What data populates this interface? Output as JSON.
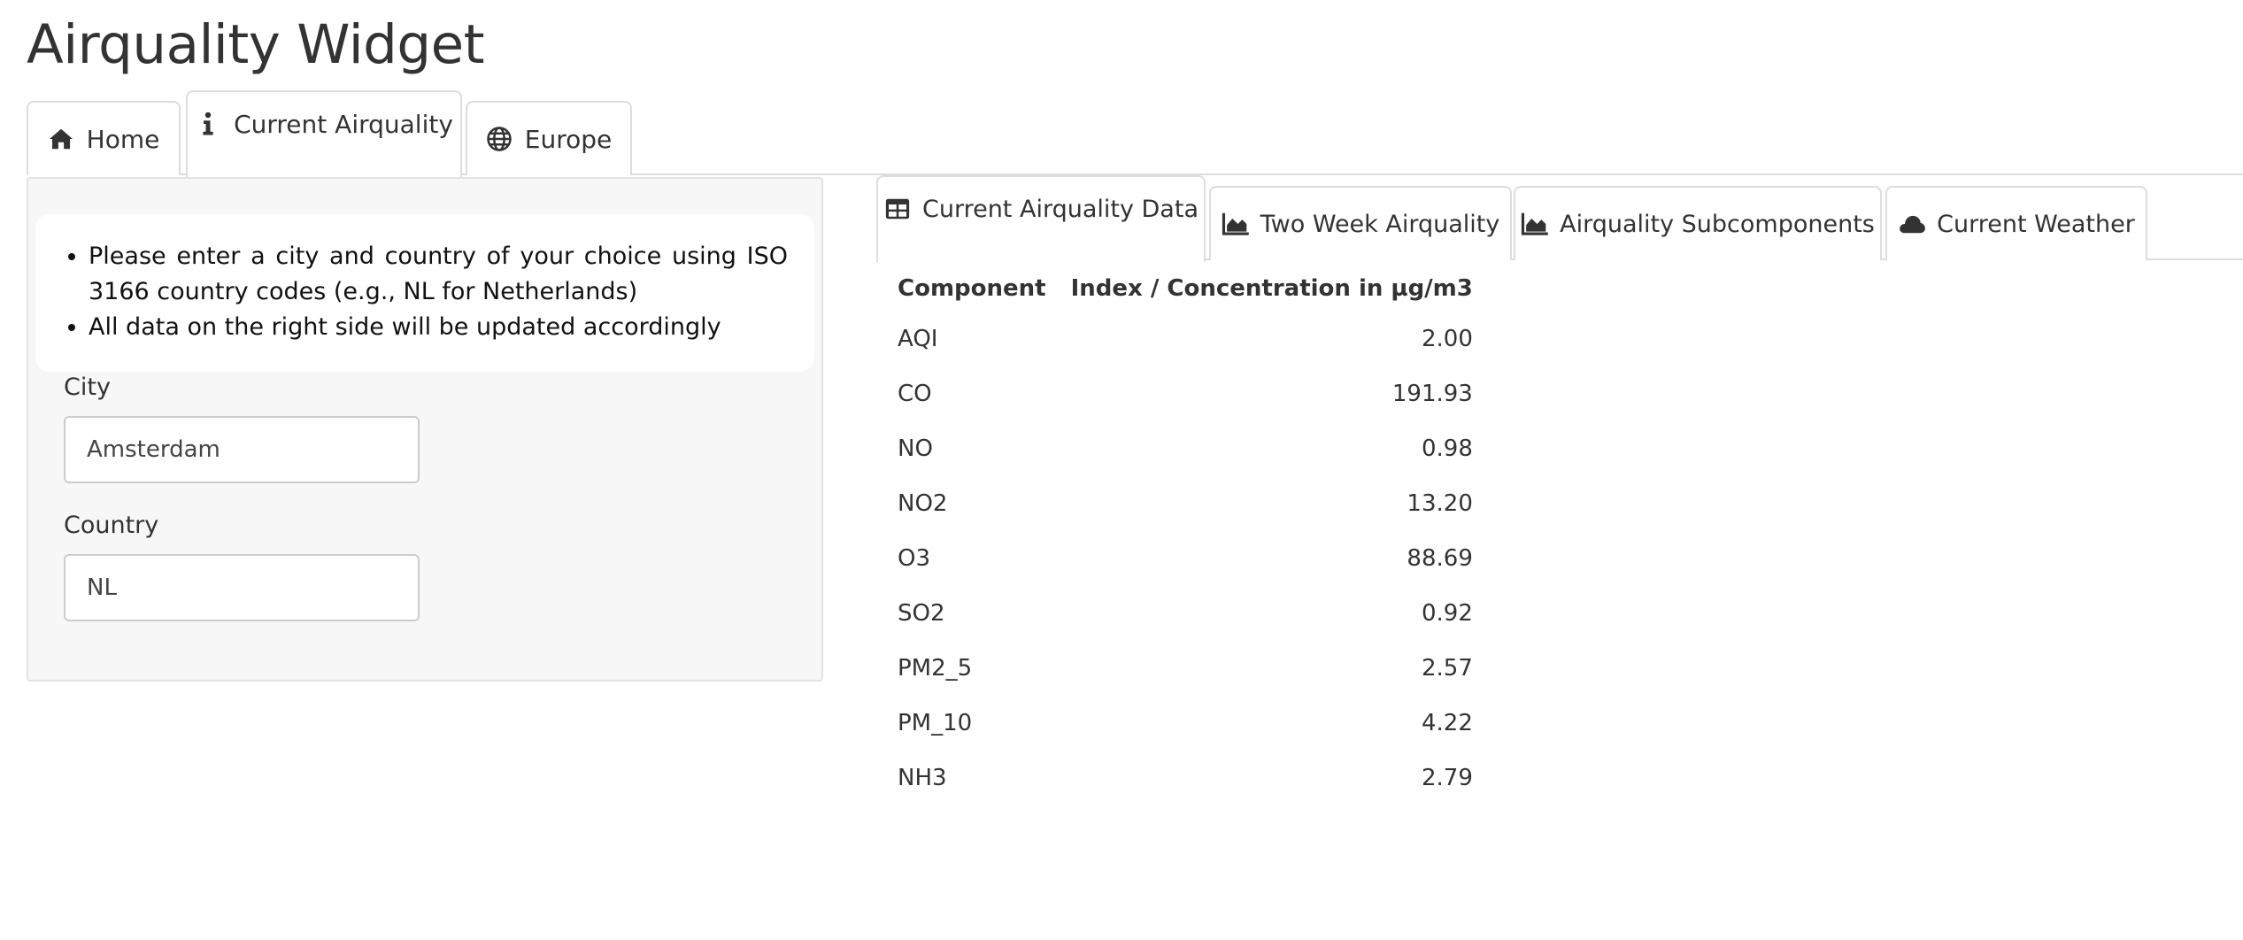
{
  "app": {
    "title": "Airquality Widget"
  },
  "main_tabs": [
    {
      "label": "Home",
      "icon": "home-icon"
    },
    {
      "label": "Current Airquality",
      "icon": "info-icon",
      "active": true
    },
    {
      "label": "Europe",
      "icon": "globe-icon"
    }
  ],
  "sidebar": {
    "instructions": [
      "Please enter a city and country of your choice using ISO 3166 country codes (e.g., NL for Netherlands)",
      "All data on the right side will be updated accordingly"
    ],
    "city": {
      "label": "City",
      "value": "Amsterdam"
    },
    "country": {
      "label": "Country",
      "value": "NL"
    }
  },
  "sub_tabs": [
    {
      "label": "Current Airquality Data",
      "icon": "table-icon",
      "active": true
    },
    {
      "label": "Two Week Airquality",
      "icon": "area-chart-icon"
    },
    {
      "label": "Airquality Subcomponents",
      "icon": "area-chart-icon"
    },
    {
      "label": "Current Weather",
      "icon": "cloud-icon"
    }
  ],
  "table": {
    "headers": [
      "Component",
      "Index / Concentration in µg/m3"
    ],
    "rows": [
      [
        "AQI",
        "2.00"
      ],
      [
        "CO",
        "191.93"
      ],
      [
        "NO",
        "0.98"
      ],
      [
        "NO2",
        "13.20"
      ],
      [
        "O3",
        "88.69"
      ],
      [
        "SO2",
        "0.92"
      ],
      [
        "PM2_5",
        "2.57"
      ],
      [
        "PM_10",
        "4.22"
      ],
      [
        "NH3",
        "2.79"
      ]
    ]
  },
  "colors": {
    "text": "#333333",
    "border": "#dddddd",
    "sidebar_bg": "#f7f7f7"
  }
}
